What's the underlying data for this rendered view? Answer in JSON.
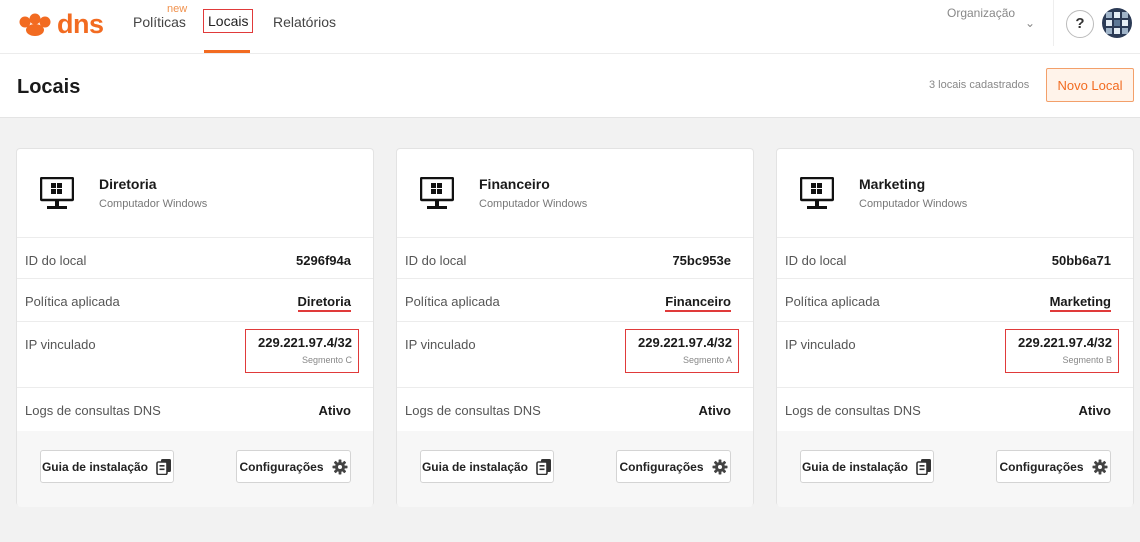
{
  "nav": {
    "logo_text": "dns",
    "items": [
      {
        "label": "Políticas",
        "badge": "new"
      },
      {
        "label": "Locais"
      },
      {
        "label": "Relatórios"
      }
    ],
    "organization_label": "Organização",
    "help_label": "?"
  },
  "header": {
    "title": "Locais",
    "count_text": "3 locais cadastrados",
    "new_button": "Novo Local"
  },
  "colors": {
    "brand": "#f26b21",
    "highlight": "#e03a3a"
  },
  "labels": {
    "id": "ID do local",
    "policy": "Política aplicada",
    "ip": "IP vinculado",
    "logs": "Logs de consultas DNS",
    "guide_button": "Guia de instalação",
    "config_button": "Configurações"
  },
  "locations": [
    {
      "name": "Diretoria",
      "type": "Computador Windows",
      "id": "5296f94a",
      "policy": "Diretoria",
      "ip": "229.221.97.4/32",
      "segment": "Segmento C",
      "logs": "Ativo"
    },
    {
      "name": "Financeiro",
      "type": "Computador Windows",
      "id": "75bc953e",
      "policy": "Financeiro",
      "ip": "229.221.97.4/32",
      "segment": "Segmento A",
      "logs": "Ativo"
    },
    {
      "name": "Marketing",
      "type": "Computador Windows",
      "id": "50bb6a71",
      "policy": "Marketing",
      "ip": "229.221.97.4/32",
      "segment": "Segmento B",
      "logs": "Ativo"
    }
  ]
}
